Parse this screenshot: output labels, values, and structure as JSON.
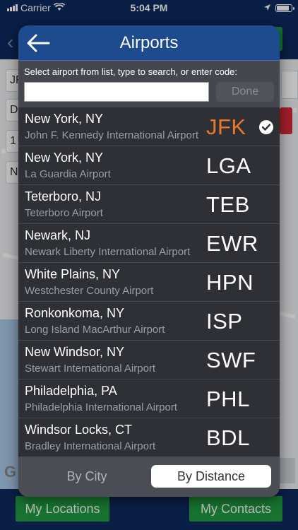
{
  "status_bar": {
    "carrier": "Carrier",
    "time": "5:04 PM"
  },
  "background": {
    "field_letters": [
      "JF",
      "D",
      "1",
      "N"
    ],
    "bottom_buttons": {
      "left": "My Locations",
      "right": "My Contacts"
    },
    "map_logo": "G"
  },
  "popup": {
    "title": "Airports",
    "search": {
      "hint": "Select airport from list, type to search, or enter code:",
      "value": "",
      "placeholder": "",
      "done_label": "Done"
    },
    "airports": [
      {
        "city": "New York, NY",
        "name": "John F. Kennedy International Airport",
        "code": "JFK",
        "selected": true
      },
      {
        "city": "New York, NY",
        "name": "La Guardia Airport",
        "code": "LGA",
        "selected": false
      },
      {
        "city": "Teterboro, NJ",
        "name": "Teterboro Airport",
        "code": "TEB",
        "selected": false
      },
      {
        "city": "Newark, NJ",
        "name": "Newark Liberty International Airport",
        "code": "EWR",
        "selected": false
      },
      {
        "city": "White Plains, NY",
        "name": "Westchester County Airport",
        "code": "HPN",
        "selected": false
      },
      {
        "city": "Ronkonkoma, NY",
        "name": "Long Island MacArthur Airport",
        "code": "ISP",
        "selected": false
      },
      {
        "city": "New Windsor, NY",
        "name": "Stewart International Airport",
        "code": "SWF",
        "selected": false
      },
      {
        "city": "Philadelphia, PA",
        "name": "Philadelphia International Airport",
        "code": "PHL",
        "selected": false
      },
      {
        "city": "Windsor Locks, CT",
        "name": "Bradley International Airport",
        "code": "BDL",
        "selected": false
      }
    ],
    "sort": {
      "by_city": "By City",
      "by_distance": "By Distance",
      "active": "By Distance"
    }
  },
  "colors": {
    "header_blue": "#1e4a8e",
    "selected_code": "#e8792b",
    "green_button": "#1f9a3f",
    "popup_bg": "#2e3035"
  },
  "icons": {
    "back": "arrow-left-icon",
    "check": "checkmark-circle-icon",
    "wifi": "wifi-icon",
    "location": "location-arrow-icon",
    "battery": "battery-icon"
  }
}
